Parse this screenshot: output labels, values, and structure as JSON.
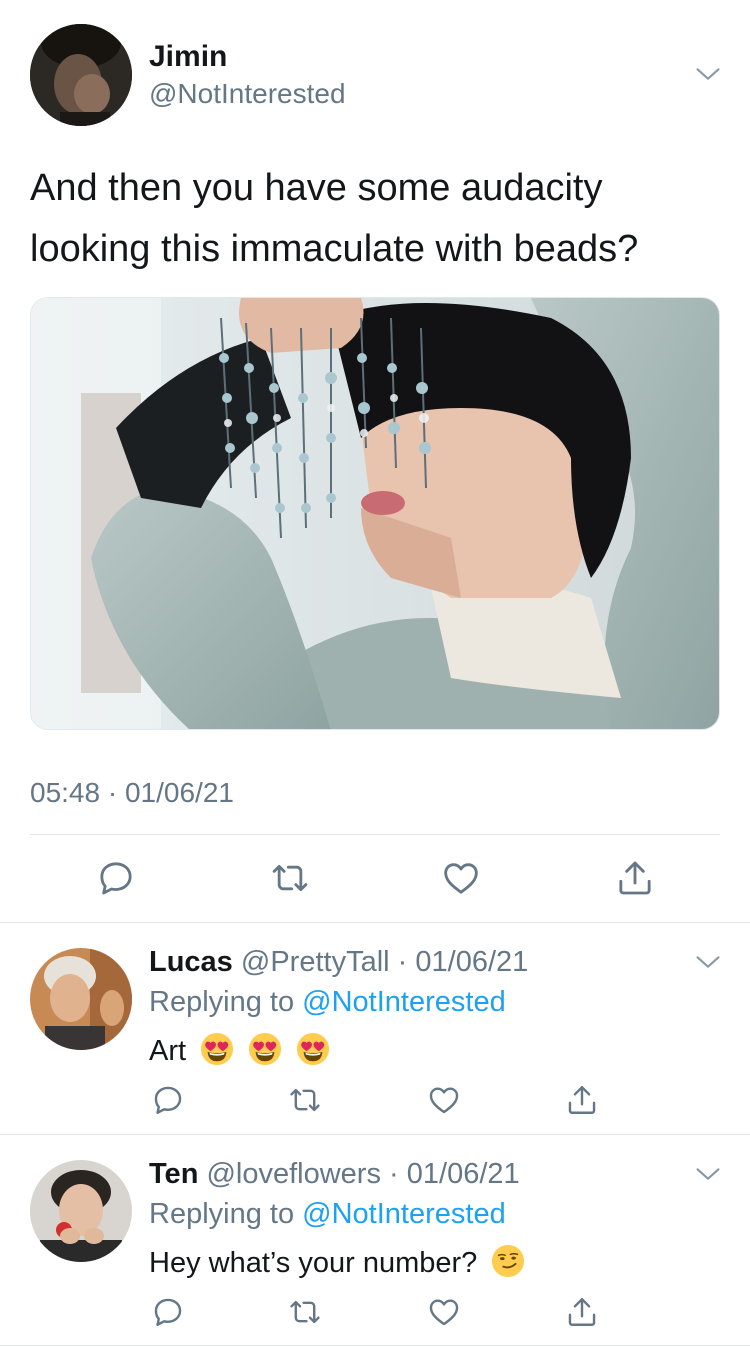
{
  "tweet": {
    "author_name": "Jimin",
    "author_handle": "@NotInterested",
    "text": "And then you have some audacity looking this immaculate with beads?",
    "time": "05:48",
    "separator": "·",
    "date": "01/06/21"
  },
  "replies": [
    {
      "name": "Lucas",
      "handle": "@PrettyTall",
      "separator": "·",
      "date": "01/06/21",
      "replying_prefix": "Replying to",
      "replying_to": "@NotInterested",
      "text": "Art",
      "emojis": [
        "heart-eyes",
        "heart-eyes",
        "heart-eyes"
      ]
    },
    {
      "name": "Ten",
      "handle": "@loveflowers",
      "separator": "·",
      "date": "01/06/21",
      "replying_prefix": "Replying to",
      "replying_to": "@NotInterested",
      "text": "Hey what’s your number?",
      "emojis": [
        "smirk"
      ]
    }
  ],
  "icons": {
    "more": "chevron-down-icon",
    "reply": "reply-icon",
    "retweet": "retweet-icon",
    "like": "heart-icon",
    "share": "share-icon"
  },
  "colors": {
    "text": "#14171a",
    "secondary": "#657786",
    "link": "#1da1f2",
    "divider": "#e1e8ed"
  }
}
